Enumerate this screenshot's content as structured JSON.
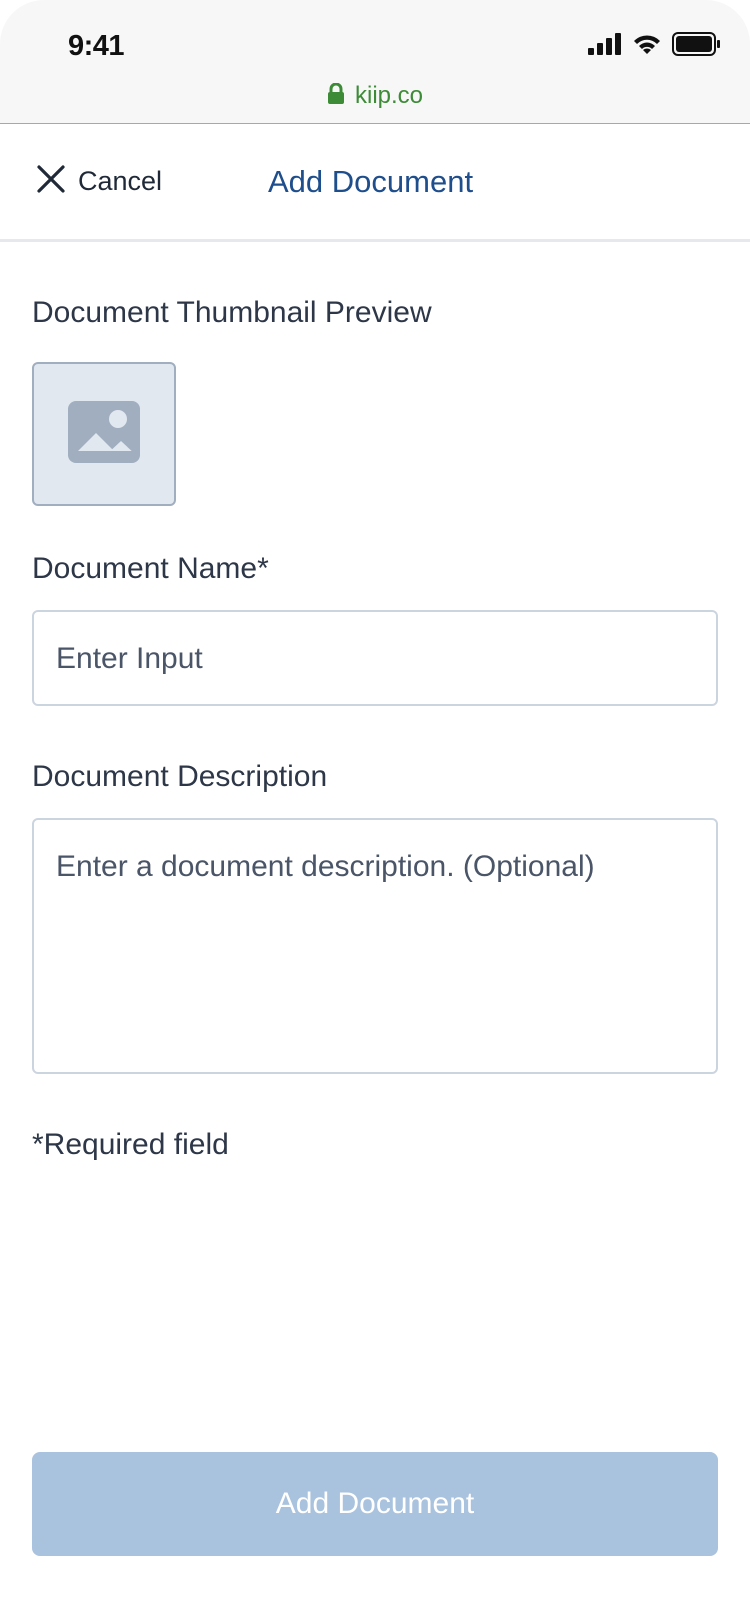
{
  "status_bar": {
    "time": "9:41",
    "url": "kiip.co",
    "icons": [
      "signal-icon",
      "wifi-icon",
      "battery-icon",
      "lock-icon"
    ]
  },
  "nav": {
    "cancel_label": "Cancel",
    "title": "Add Document"
  },
  "form": {
    "thumbnail_label": "Document Thumbnail Preview",
    "name_label": "Document Name*",
    "name_placeholder": "Enter Input",
    "description_label": "Document Description",
    "description_placeholder": "Enter a document description. (Optional)",
    "required_note": "*Required field",
    "submit_label": "Add Document"
  },
  "colors": {
    "url_green": "#3d8b37",
    "title_blue": "#1e4e8c",
    "button_disabled": "#a9c2de",
    "thumb_bg": "#e2e8f0"
  }
}
